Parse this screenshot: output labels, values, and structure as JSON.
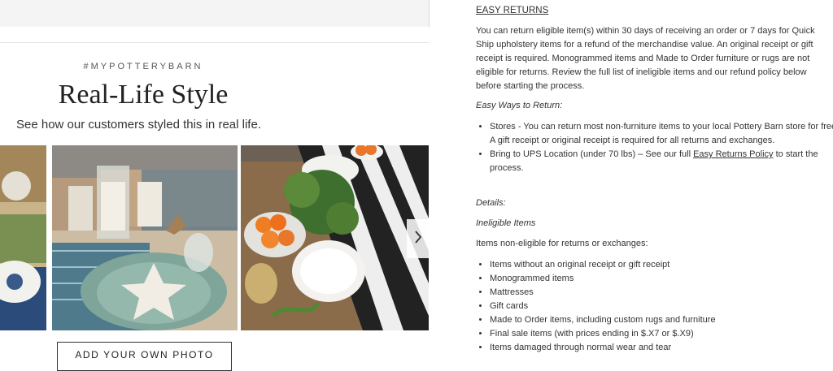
{
  "gallery_section": {
    "hashtag": "#MYPOTTERYBARN",
    "title": "Real-Life Style",
    "subtitle": "See how our customers styled this in real life.",
    "photos": [
      {
        "description": "customer photo partial table setting"
      },
      {
        "description": "customer photo candle centerpiece with starfish plate"
      },
      {
        "description": "customer photo table with oranges and greenery"
      }
    ],
    "next_icon": "chevron-right-icon",
    "add_photo_label": "ADD YOUR OWN PHOTO"
  },
  "returns": {
    "title": "EASY RETURNS",
    "intro": "You can return eligible item(s) within 30 days of receiving an order or 7 days for Quick Ship upholstery items for a refund of the merchandise value. An original receipt or gift receipt is required. Monogrammed items and Made to Order furniture or rugs are not eligible for returns. Review the full list of ineligible items and our refund policy below before starting the process.",
    "ways_heading": "Easy Ways to Return:",
    "ways": {
      "stores": "Stores - You can return most non-furniture items to your local Pottery Barn store for free. A gift receipt or original receipt is required for all returns and exchanges.",
      "ups_prefix": "Bring to UPS Location (under 70 lbs) – See our full ",
      "ups_link": "Easy Returns Policy",
      "ups_suffix": " to start the process."
    },
    "details_heading": "Details:",
    "ineligible_heading": "Ineligible Items",
    "items_intro": "Items non-eligible for returns or exchanges:",
    "ineligible_items": [
      "Items without an original receipt or gift receipt",
      "Monogrammed items",
      "Mattresses",
      "Gift cards",
      "Made to Order items, including custom rugs and furniture",
      "Final sale items (with prices ending in $.X7 or $.X9)",
      "Items damaged through normal wear and tear"
    ]
  }
}
